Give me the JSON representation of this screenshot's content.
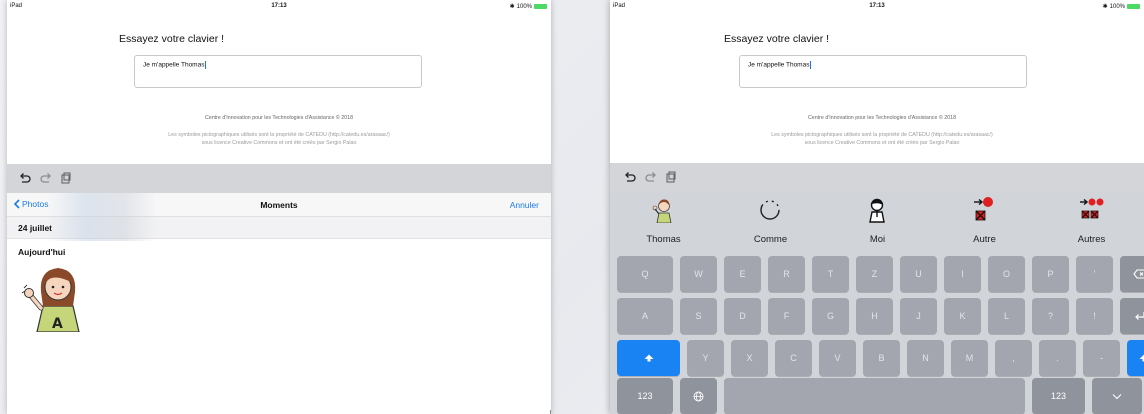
{
  "left_device": {
    "status": {
      "carrier": "iPad",
      "time": "17:13",
      "battery": "100%"
    },
    "app_title": "Essayez votre clavier !",
    "input_value": "Je m'appelle Thomas",
    "credit": "Centre d'Innovation pour les Technologies d'Assistance © 2018",
    "license_line1": "Les symboles pictographiques utilisés sont la propriété de CATEDU (http://catedu.es/arasaac/)",
    "license_line2": "sous licence Creative Commons et ont été créés par Sergio Palao",
    "photos": {
      "back_label": "Photos",
      "title": "Moments",
      "cancel_label": "Annuler",
      "date": "24 juillet",
      "section": "Aujourd'hui"
    }
  },
  "right_device": {
    "status": {
      "carrier": "iPad",
      "time": "17:13",
      "battery": "100%"
    },
    "app_title": "Essayez votre clavier !",
    "input_value": "Je m'appelle Thomas",
    "credit": "Centre d'Innovation pour les Technologies d'Assistance © 2018",
    "license_line1": "Les symboles pictographiques utilisés sont la propriété de CATEDU (http://catedu.es/arasaac/)",
    "license_line2": "sous licence Creative Commons et ont été créés par Sergio Palao",
    "suggestions": [
      "Thomas",
      "Comme",
      "Moi",
      "Autre",
      "Autres"
    ],
    "keyboard": {
      "row1": [
        "Q",
        "W",
        "E",
        "R",
        "T",
        "Z",
        "U",
        "I",
        "O",
        "P",
        "'"
      ],
      "row2": [
        "A",
        "S",
        "D",
        "F",
        "G",
        "H",
        "J",
        "K",
        "L",
        "?",
        "!"
      ],
      "row3": [
        "Y",
        "X",
        "C",
        "V",
        "B",
        "N",
        "M",
        ",",
        ".",
        "-"
      ],
      "numbers_label": "123"
    }
  },
  "colors": {
    "accent": "#1a7bea",
    "shift_active": "#1a83f4",
    "key": "#a3a6ae",
    "keyboard_bg": "#d1d4d9"
  }
}
